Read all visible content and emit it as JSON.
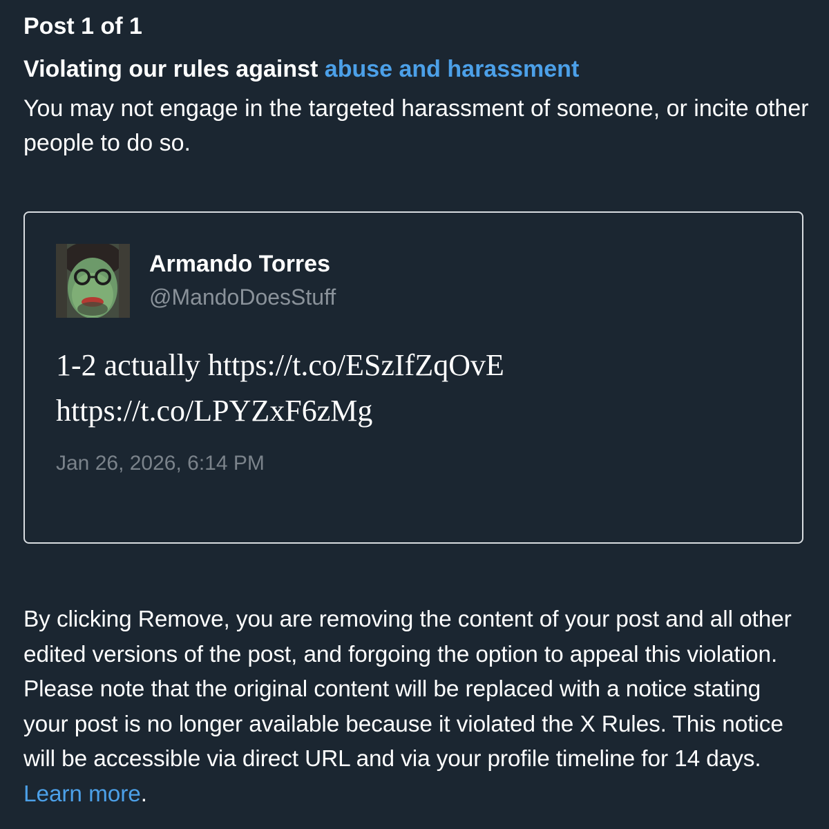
{
  "header": {
    "post_counter": "Post 1 of 1"
  },
  "violation": {
    "title_prefix": "Violating our rules against ",
    "rule_link": "abuse and harassment",
    "description": "You may not engage in the targeted harassment of someone, or incite other people to do so."
  },
  "tweet": {
    "display_name": "Armando Torres",
    "handle": "@MandoDoesStuff",
    "text_line1": "1-2 actually https://t.co/ESzIfZqOvE",
    "text_line2": "https://t.co/LPYZxF6zMg",
    "timestamp": "Jan 26, 2026, 6:14 PM"
  },
  "notice": {
    "body": "By clicking Remove, you are removing the content of your post and all other edited versions of the post, and forgoing the option to appeal this violation. Please note that the original content will be replaced with a notice stating your post is no longer available because it violated the X Rules. This notice will be accessible via direct URL and via your profile timeline for 14 days. ",
    "learn_more": "Learn more",
    "trailing": "."
  },
  "colors": {
    "background": "#1b2631",
    "link": "#4ca0e8",
    "card_border": "#d9dde1",
    "muted_text": "#8a929a"
  },
  "icons": {
    "avatar": "user-avatar-photo"
  }
}
